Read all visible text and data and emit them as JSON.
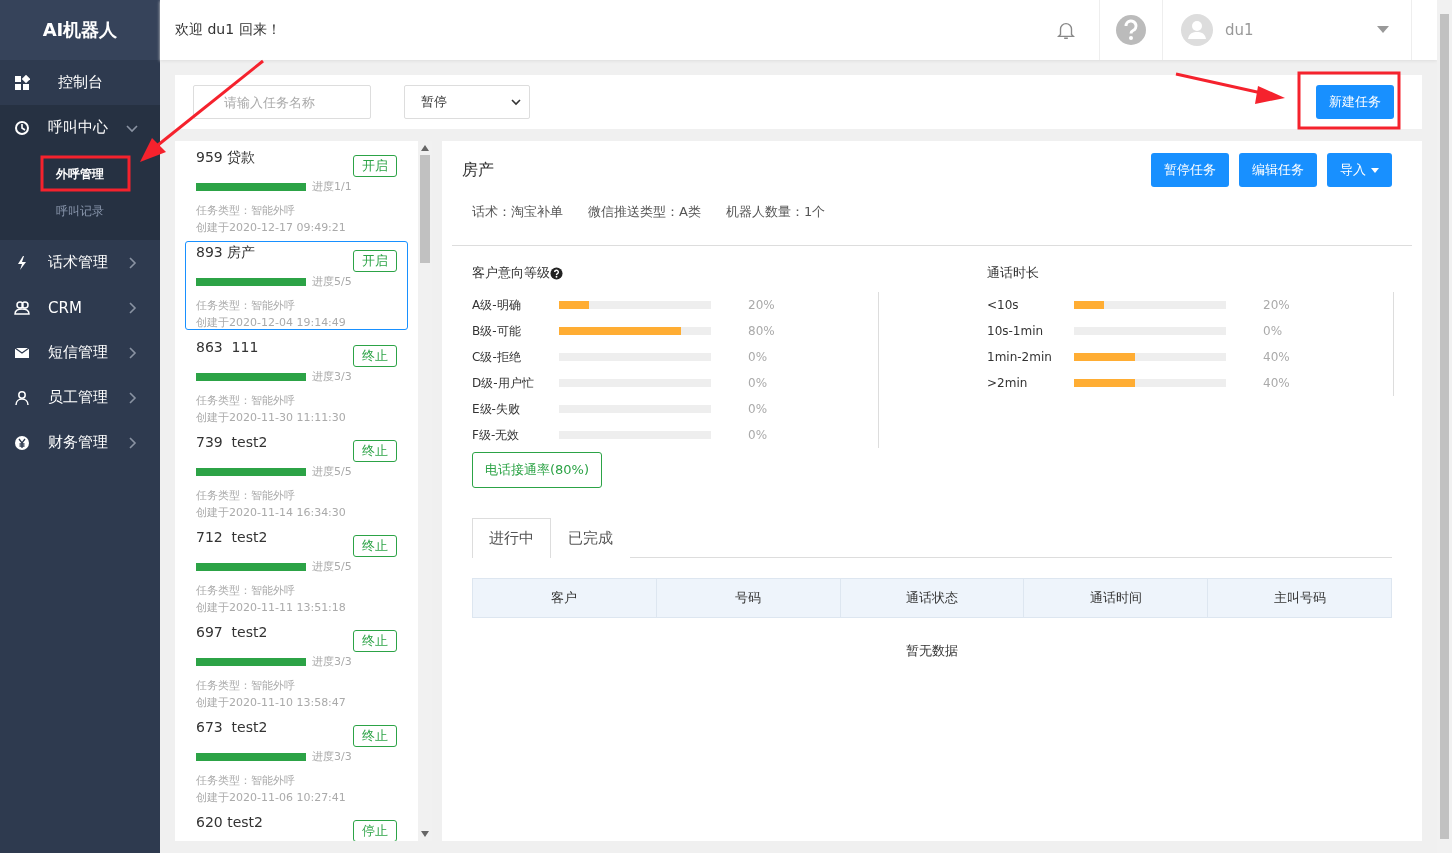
{
  "sidebar": {
    "logo": "AI机器人",
    "items": [
      {
        "label": "控制台",
        "kind": "plain",
        "expanded": false
      },
      {
        "label": "呼叫中心",
        "kind": "group",
        "expanded": true,
        "children": [
          {
            "label": "外呼管理",
            "selected": true
          },
          {
            "label": "呼叫记录",
            "selected": false
          }
        ]
      },
      {
        "label": "话术管理",
        "kind": "group",
        "expanded": false
      },
      {
        "label": "CRM",
        "kind": "group",
        "expanded": false
      },
      {
        "label": "短信管理",
        "kind": "group",
        "expanded": false
      },
      {
        "label": "员工管理",
        "kind": "group",
        "expanded": false
      },
      {
        "label": "财务管理",
        "kind": "group",
        "expanded": false
      }
    ]
  },
  "header": {
    "welcome": "欢迎 du1 回来！",
    "user": "du1"
  },
  "toolbar": {
    "search": {
      "placeholder": "请输入任务名称"
    },
    "status_select": "暂停",
    "new_button": "新建任务"
  },
  "tasks": [
    {
      "title": "959 贷款",
      "status": "开启",
      "selected": false,
      "level": 1,
      "progress": "进度1/1",
      "type": "任务类型：智能外呼",
      "created": "创建于2020-12-17 09:49:21"
    },
    {
      "title": "893 房产",
      "status": "开启",
      "selected": true,
      "level": 1,
      "progress": "进度5/5",
      "type": "任务类型：智能外呼",
      "created": "创建于2020-12-04 19:14:49"
    },
    {
      "title": "863  111",
      "status": "终止",
      "selected": false,
      "level": 1,
      "progress": "进度3/3",
      "type": "任务类型：智能外呼",
      "created": "创建于2020-11-30 11:11:30"
    },
    {
      "title": "739  test2",
      "status": "终止",
      "selected": false,
      "level": 1,
      "progress": "进度5/5",
      "type": "任务类型：智能外呼",
      "created": "创建于2020-11-14 16:34:30"
    },
    {
      "title": "712  test2",
      "status": "终止",
      "selected": false,
      "level": 1,
      "progress": "进度5/5",
      "type": "任务类型：智能外呼",
      "created": "创建于2020-11-11 13:51:18"
    },
    {
      "title": "697  test2",
      "status": "终止",
      "selected": false,
      "level": 1,
      "progress": "进度3/3",
      "type": "任务类型：智能外呼",
      "created": "创建于2020-11-10 13:58:47"
    },
    {
      "title": "673  test2",
      "status": "终止",
      "selected": false,
      "level": 1,
      "progress": "进度3/3",
      "type": "任务类型：智能外呼",
      "created": "创建于2020-11-06 10:27:41"
    },
    {
      "title": "620 test2",
      "status": "停止",
      "selected": false
    }
  ],
  "detail": {
    "title": "房产",
    "buttons": [
      {
        "label": "暂停任务",
        "kind": "plain"
      },
      {
        "label": "编辑任务",
        "kind": "plain"
      },
      {
        "label": "导入",
        "kind": "dropdown"
      }
    ],
    "info": [
      "话术：淘宝补单",
      "微信推送类型：A类",
      "机器人数量：1个"
    ],
    "intent": {
      "title": "客户意向等级",
      "rows": [
        {
          "label": "A级-明确",
          "level": 0.2,
          "reading": "20%"
        },
        {
          "label": "B级-可能",
          "level": 0.8,
          "reading": "80%"
        },
        {
          "label": "C级-拒绝",
          "level": 0,
          "reading": "0%"
        },
        {
          "label": "D级-用户忙",
          "level": 0,
          "reading": "0%"
        },
        {
          "label": "E级-失败",
          "level": 0,
          "reading": "0%"
        },
        {
          "label": "F级-无效",
          "level": 0,
          "reading": "0%"
        }
      ]
    },
    "duration": {
      "title": "通话时长",
      "rows": [
        {
          "label": "<10s",
          "level": 0.2,
          "reading": "20%"
        },
        {
          "label": "10s-1min",
          "level": 0,
          "reading": "0%"
        },
        {
          "label": "1min-2min",
          "level": 0.4,
          "reading": "40%"
        },
        {
          "label": ">2min",
          "level": 0.4,
          "reading": "40%"
        }
      ]
    },
    "connect_rate": "电话接通率(80%)",
    "tabs": [
      {
        "label": "进行中",
        "selected": true
      },
      {
        "label": "已完成",
        "selected": false
      }
    ],
    "table": {
      "columns": [
        "客户",
        "号码",
        "通话状态",
        "通话时间",
        "主叫号码"
      ],
      "empty": "暂无数据"
    }
  }
}
